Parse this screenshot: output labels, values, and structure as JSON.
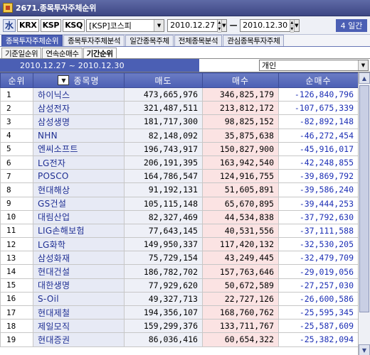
{
  "window": {
    "title": "2671.종목투자주체순위"
  },
  "toolbar": {
    "app_icon_glyph": "水",
    "markets": [
      "KRX",
      "KSP",
      "KSQ"
    ],
    "market_combo": "[KSP]코스피",
    "date_from": "2010.12.27",
    "date_to": "2010.12.30",
    "separator": "—",
    "period": "4 일간"
  },
  "main_tabs": [
    "종목투자주체순위",
    "종목투자주체분석",
    "일간종목주체",
    "전체종목분석",
    "관심종목투자주체"
  ],
  "sub_tabs": [
    "기준일순위",
    "연속순매수",
    "기간순위"
  ],
  "range": {
    "label": "2010.12.27 ~ 2010.12.30",
    "investor": "개인"
  },
  "table": {
    "headers": {
      "rank": "순위",
      "name": "종목명",
      "sell": "매도",
      "buy": "매수",
      "net": "순매수"
    },
    "sort_icon": "sort-down-icon",
    "rows": [
      {
        "rank": "1",
        "name": "하이닉스",
        "sell": "473,665,976",
        "buy": "346,825,179",
        "net": "-126,840,796"
      },
      {
        "rank": "2",
        "name": "삼성전자",
        "sell": "321,487,511",
        "buy": "213,812,172",
        "net": "-107,675,339"
      },
      {
        "rank": "3",
        "name": "삼성생명",
        "sell": "181,717,300",
        "buy": "98,825,152",
        "net": "-82,892,148"
      },
      {
        "rank": "4",
        "name": "NHN",
        "sell": "82,148,092",
        "buy": "35,875,638",
        "net": "-46,272,454"
      },
      {
        "rank": "5",
        "name": "엔씨소프트",
        "sell": "196,743,917",
        "buy": "150,827,900",
        "net": "-45,916,017"
      },
      {
        "rank": "6",
        "name": "LG전자",
        "sell": "206,191,395",
        "buy": "163,942,540",
        "net": "-42,248,855"
      },
      {
        "rank": "7",
        "name": "POSCO",
        "sell": "164,786,547",
        "buy": "124,916,755",
        "net": "-39,869,792"
      },
      {
        "rank": "8",
        "name": "현대해상",
        "sell": "91,192,131",
        "buy": "51,605,891",
        "net": "-39,586,240"
      },
      {
        "rank": "9",
        "name": "GS건설",
        "sell": "105,115,148",
        "buy": "65,670,895",
        "net": "-39,444,253"
      },
      {
        "rank": "10",
        "name": "대림산업",
        "sell": "82,327,469",
        "buy": "44,534,838",
        "net": "-37,792,630"
      },
      {
        "rank": "11",
        "name": "LIG손해보험",
        "sell": "77,643,145",
        "buy": "40,531,556",
        "net": "-37,111,588"
      },
      {
        "rank": "12",
        "name": "LG화학",
        "sell": "149,950,337",
        "buy": "117,420,132",
        "net": "-32,530,205"
      },
      {
        "rank": "13",
        "name": "삼성화재",
        "sell": "75,729,154",
        "buy": "43,249,445",
        "net": "-32,479,709"
      },
      {
        "rank": "14",
        "name": "현대건설",
        "sell": "186,782,702",
        "buy": "157,763,646",
        "net": "-29,019,056"
      },
      {
        "rank": "15",
        "name": "대한생명",
        "sell": "77,929,620",
        "buy": "50,672,589",
        "net": "-27,257,030"
      },
      {
        "rank": "16",
        "name": "S-Oil",
        "sell": "49,327,713",
        "buy": "22,727,126",
        "net": "-26,600,586"
      },
      {
        "rank": "17",
        "name": "현대제철",
        "sell": "194,356,107",
        "buy": "168,760,762",
        "net": "-25,595,345"
      },
      {
        "rank": "18",
        "name": "제일모직",
        "sell": "159,299,376",
        "buy": "133,711,767",
        "net": "-25,587,609"
      },
      {
        "rank": "19",
        "name": "현대증권",
        "sell": "86,036,416",
        "buy": "60,654,322",
        "net": "-25,382,094"
      }
    ]
  },
  "colors": {
    "header_blue": "#4b5fb4",
    "buy_bg": "#fbe3e3",
    "net_text": "#1c2fb5",
    "name_text": "#1f2f93"
  }
}
